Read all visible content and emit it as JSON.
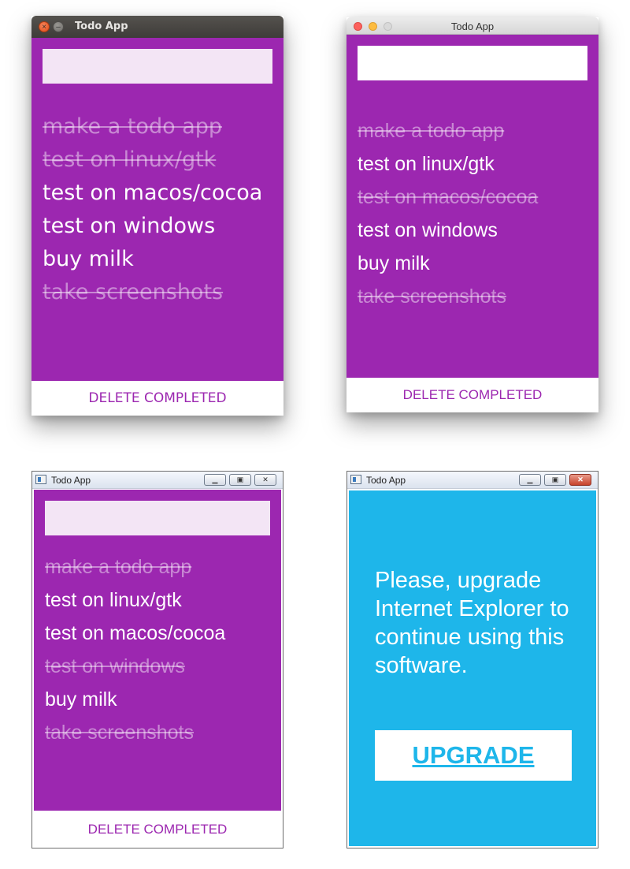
{
  "colors": {
    "purple": "#9c27b0",
    "input_tint": "#f3e5f5",
    "ie_blue": "#1eb6ea"
  },
  "linux": {
    "title": "Todo App",
    "input_value": "",
    "items": [
      {
        "text": "make a todo app",
        "done": true
      },
      {
        "text": "test on linux/gtk",
        "done": true
      },
      {
        "text": "test on macos/cocoa",
        "done": false
      },
      {
        "text": "test on windows",
        "done": false
      },
      {
        "text": "buy milk",
        "done": false
      },
      {
        "text": "take screenshots",
        "done": true
      }
    ],
    "footer": "DELETE COMPLETED"
  },
  "mac": {
    "title": "Todo App",
    "input_value": "",
    "items": [
      {
        "text": "make a todo app",
        "done": true
      },
      {
        "text": "test on linux/gtk",
        "done": false
      },
      {
        "text": "test on macos/cocoa",
        "done": true
      },
      {
        "text": "test on windows",
        "done": false
      },
      {
        "text": "buy milk",
        "done": false
      },
      {
        "text": "take screenshots",
        "done": true
      }
    ],
    "footer": "DELETE COMPLETED"
  },
  "windows": {
    "title": "Todo App",
    "input_value": "",
    "items": [
      {
        "text": "make a todo app",
        "done": true
      },
      {
        "text": "test on linux/gtk",
        "done": false
      },
      {
        "text": "test on macos/cocoa",
        "done": false
      },
      {
        "text": "test on windows",
        "done": true
      },
      {
        "text": "buy milk",
        "done": false
      },
      {
        "text": "take screenshots",
        "done": true
      }
    ],
    "footer": "DELETE COMPLETED"
  },
  "ie": {
    "title": "Todo App",
    "message": "Please, upgrade Internet Explorer to continue using this software.",
    "button": "UPGRADE"
  }
}
